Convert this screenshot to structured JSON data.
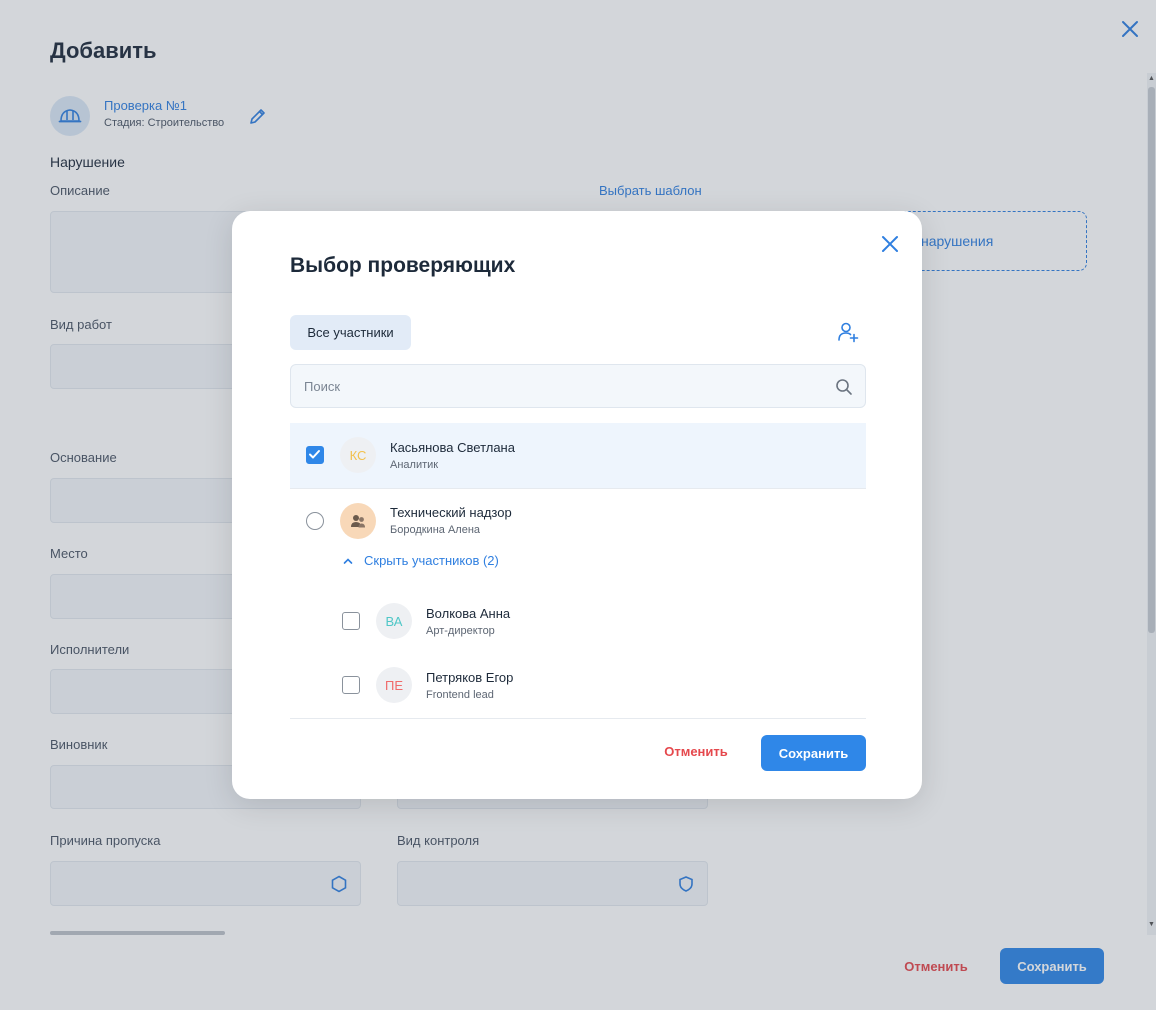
{
  "page": {
    "title": "Добавить",
    "inspection": {
      "name": "Проверка №1",
      "stage": "Стадия: Строительство"
    },
    "section_title": "Нарушение",
    "fields": {
      "description": "Описание",
      "choose_template": "Выбрать шаблон",
      "violation_button_partial": "нарушения",
      "work_type": "Вид работ",
      "basis": "Основание",
      "place": "Место",
      "executors": "Исполнители",
      "culprit": "Виновник",
      "skip_reason": "Причина пропуска",
      "control_type": "Вид контроля"
    },
    "footer": {
      "cancel": "Отменить",
      "save": "Сохранить"
    }
  },
  "modal": {
    "title": "Выбор проверяющих",
    "filter_chip": "Все участники",
    "search_placeholder": "Поиск",
    "people": [
      {
        "initials": "КС",
        "name": "Касьянова Светлана",
        "role": "Аналитик",
        "checked": true,
        "color": "#f2c14e"
      },
      {
        "name": "Технический надзор",
        "role": "Бородкина Алена",
        "group": true
      },
      {
        "initials": "ВА",
        "name": "Волкова Анна",
        "role": "Арт-директор",
        "checked": false,
        "color": "#4fc7c7"
      },
      {
        "initials": "ПЕ",
        "name": "Петряков Егор",
        "role": "Frontend lead",
        "checked": false,
        "color": "#f06a6a"
      }
    ],
    "toggle_label": "Скрыть участников (2)",
    "cancel": "Отменить",
    "save": "Сохранить"
  },
  "colors": {
    "accent": "#2f87e8",
    "danger": "#e5484d",
    "link": "#2f7fe0"
  }
}
